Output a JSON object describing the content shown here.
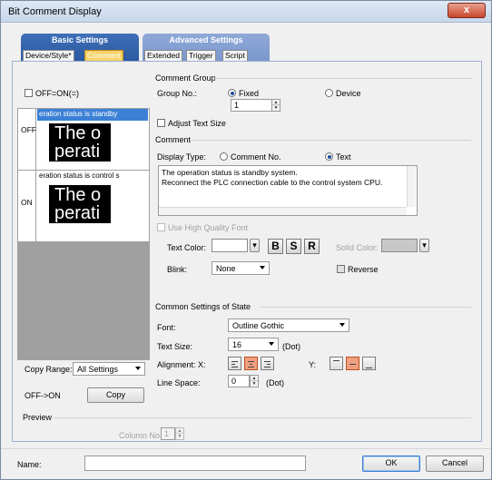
{
  "window": {
    "title": "Bit Comment Display",
    "close_symbol": "x"
  },
  "tabs": {
    "basic_settings": "Basic Settings",
    "advanced_settings": "Advanced Settings",
    "basic_subtabs": [
      "Device/Style*",
      "Comment"
    ],
    "advanced_subtabs": [
      "Extended",
      "Trigger",
      "Script"
    ]
  },
  "left": {
    "off_on_label": "OFF=ON(=)",
    "states": [
      {
        "label": "OFF",
        "caption": "eration status is standby",
        "preview": "The o\nperati"
      },
      {
        "label": "ON",
        "caption": "eration status is control s",
        "preview": "The o\nperati"
      }
    ],
    "copy_range_label": "Copy Range:",
    "copy_range_value": "All Settings",
    "off_on_copy_label": "OFF->ON",
    "copy_button": "Copy"
  },
  "comment_group": {
    "section": "Comment Group",
    "group_no_label": "Group No.:",
    "fixed": "Fixed",
    "device": "Device",
    "group_no_value": "1",
    "adjust_text_size": "Adjust Text Size"
  },
  "comment": {
    "section": "Comment",
    "display_type_label": "Display Type:",
    "comment_no": "Comment No.",
    "text": "Text",
    "text_value_line1": "The operation status is standby system.",
    "text_value_line2": "Reconnect the PLC connection cable to the control system CPU.",
    "use_high_quality_font": "Use High Quality Font",
    "text_color_label": "Text Color:",
    "bold": "B",
    "shadow": "S",
    "raised": "R",
    "solid_color_label": "Solid Color:",
    "blink_label": "Blink:",
    "blink_value": "None",
    "reverse": "Reverse"
  },
  "common": {
    "section": "Common Settings of State",
    "font_label": "Font:",
    "font_value": "Outline Gothic",
    "text_size_label": "Text Size:",
    "text_size_value": "16",
    "dot": "(Dot)",
    "alignment_label": "Alignment: X:",
    "y_label": "Y:",
    "line_space_label": "Line Space:",
    "line_space_value": "0",
    "dot2": "(Dot)"
  },
  "preview": {
    "section": "Preview",
    "column_no_label": "Column No.:",
    "column_no_value": "1"
  },
  "footer": {
    "name_label": "Name:",
    "name_value": "",
    "ok": "OK",
    "cancel": "Cancel"
  },
  "colors": {
    "accent": "#2b5aa2",
    "selected_tab": "#f6d36a",
    "preview_bg": "#000000"
  }
}
